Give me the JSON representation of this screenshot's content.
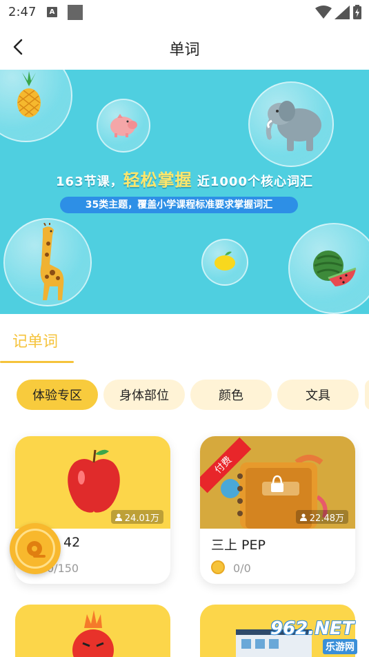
{
  "status_bar": {
    "time": "2:47",
    "notification_letter": "A"
  },
  "app_bar": {
    "title": "单词"
  },
  "banner": {
    "headline_prefix": "163节课，",
    "headline_highlight": "轻松掌握",
    "headline_suffix": "近1000个核心词汇",
    "subline": "35类主题，覆盖小学课程标准要求掌握词汇"
  },
  "section": {
    "tab_label": "记单词"
  },
  "categories": [
    {
      "label": "体验专区",
      "active": true
    },
    {
      "label": "身体部位",
      "active": false
    },
    {
      "label": "颜色",
      "active": false
    },
    {
      "label": "文具",
      "active": false
    }
  ],
  "cards": [
    {
      "title": "42",
      "views": "24.01万",
      "progress": "0/150",
      "paid": false
    },
    {
      "title": "三上 PEP",
      "views": "22.48万",
      "progress": "0/0",
      "paid": true,
      "ribbon": "付费"
    }
  ],
  "watermark": {
    "brand": "962.NET",
    "sub": "乐游网"
  },
  "colors": {
    "accent": "#f5c33b",
    "banner_bg": "#4fcfe0",
    "chip_bg": "#fff3d6",
    "chip_active": "#f8cb3d",
    "paid_red": "#e8262a"
  }
}
